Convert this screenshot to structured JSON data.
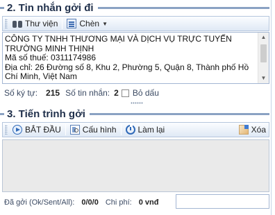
{
  "compose": {
    "section_title": "2. Tin nhắn gởi đi",
    "toolbar": {
      "library_label": "Thư viện",
      "insert_label": "Chèn"
    },
    "message_text": "CÔNG TY TNHH THƯƠNG MẠI VÀ DỊCH VỤ TRỰC TUYẾN TRƯỜNG MINH THỊNH\nMã số thuế: 0311174986\nĐịa chỉ: 26 Đường số 8, Khu 2, Phường 5, Quận 8, Thành phố Hồ Chí Minh, Việt Nam",
    "char_count_label": "Số ký tự:",
    "char_count_value": "215",
    "msg_count_label": "Số tin nhắn:",
    "msg_count_value": "2",
    "no_accent_label": "Bỏ dấu",
    "no_accent_checked": false
  },
  "process": {
    "section_title": "3. Tiến trình gởi",
    "toolbar": {
      "start_label": "BẮT ĐẦU",
      "config_label": "Cấu hình",
      "reset_label": "Làm lại",
      "clear_label": "Xóa"
    },
    "sent_label": "Đã gởi (Ok/Sent/All):",
    "sent_value": "0/0/0",
    "cost_label": "Chi phí:",
    "cost_value": "0 vnđ"
  },
  "colors": {
    "accent": "#8aa2c3",
    "title_text": "#1f2f4a",
    "toolbar_border": "#b5c6dd"
  },
  "icons": [
    "binoculars-icon",
    "insert-icon",
    "chevron-down-icon",
    "play-icon",
    "config-icon",
    "reload-icon",
    "clear-icon"
  ]
}
